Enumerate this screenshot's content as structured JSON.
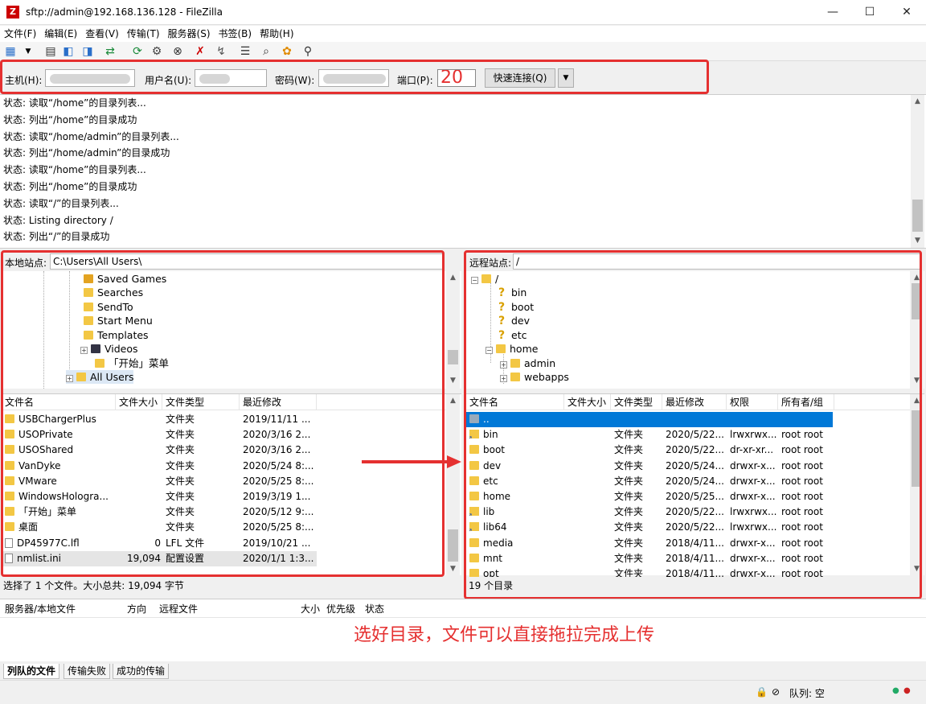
{
  "window": {
    "title": "sftp://admin@192.168.136.128 - FileZilla"
  },
  "menu": [
    "文件(F)",
    "编辑(E)",
    "查看(V)",
    "传输(T)",
    "服务器(S)",
    "书签(B)",
    "帮助(H)"
  ],
  "toolbar_icons": [
    "site-manager-icon",
    "dropdown-icon",
    "toggle-log-icon",
    "toggle-local-tree-icon",
    "toggle-remote-tree-icon",
    "toggle-queue-icon",
    "refresh-icon",
    "process-queue-icon",
    "cancel-icon",
    "disconnect-icon",
    "reconnect-icon",
    "filter-icon",
    "compare-icon",
    "sync-browse-icon",
    "search-icon"
  ],
  "quickconnect": {
    "host_label": "主机(H):",
    "host_value": "",
    "user_label": "用户名(U):",
    "user_value": "",
    "pass_label": "密码(W):",
    "pass_value": "",
    "port_label": "端口(P):",
    "port_value": "20",
    "connect_label": "快速连接(Q)"
  },
  "log": [
    "状态:  读取“/home”的目录列表...",
    "状态:  列出“/home”的目录成功",
    "状态:  读取“/home/admin”的目录列表...",
    "状态:  列出“/home/admin”的目录成功",
    "状态:  读取“/home”的目录列表...",
    "状态:  列出“/home”的目录成功",
    "状态:  读取“/”的目录列表...",
    "状态:  Listing directory /",
    "状态:  列出“/”的目录成功"
  ],
  "local": {
    "site_label": "本地站点:",
    "path": "C:\\Users\\All Users\\",
    "tree": [
      "Saved Games",
      "Searches",
      "SendTo",
      "Start Menu",
      "Templates",
      "Videos",
      "「开始」菜单",
      "All Users"
    ],
    "headers": [
      "文件名",
      "文件大小",
      "文件类型",
      "最近修改"
    ],
    "files": [
      {
        "name": "USBChargerPlus",
        "size": "",
        "type": "文件夹",
        "modified": "2019/11/11 ..."
      },
      {
        "name": "USOPrivate",
        "size": "",
        "type": "文件夹",
        "modified": "2020/3/16 2..."
      },
      {
        "name": "USOShared",
        "size": "",
        "type": "文件夹",
        "modified": "2020/3/16 2..."
      },
      {
        "name": "VanDyke",
        "size": "",
        "type": "文件夹",
        "modified": "2020/5/24 8:..."
      },
      {
        "name": "VMware",
        "size": "",
        "type": "文件夹",
        "modified": "2020/5/25 8:..."
      },
      {
        "name": "WindowsHologra...",
        "size": "",
        "type": "文件夹",
        "modified": "2019/3/19 1..."
      },
      {
        "name": "「开始」菜单",
        "size": "",
        "type": "文件夹",
        "modified": "2020/5/12 9:..."
      },
      {
        "name": "桌面",
        "size": "",
        "type": "文件夹",
        "modified": "2020/5/25 8:..."
      },
      {
        "name": "DP45977C.lfl",
        "size": "0",
        "type": "LFL 文件",
        "modified": "2019/10/21 ..."
      },
      {
        "name": "nmlist.ini",
        "size": "19,094",
        "type": "配置设置",
        "modified": "2020/1/1 1:3..."
      }
    ],
    "status": "选择了 1 个文件。大小总共: 19,094 字节"
  },
  "remote": {
    "site_label": "远程站点:",
    "path": "/",
    "tree": [
      "/",
      "bin",
      "boot",
      "dev",
      "etc",
      "home",
      "admin",
      "webapps"
    ],
    "headers": [
      "文件名",
      "文件大小",
      "文件类型",
      "最近修改",
      "权限",
      "所有者/组"
    ],
    "files": [
      {
        "name": "..",
        "size": "",
        "type": "",
        "modified": "",
        "perm": "",
        "owner": ""
      },
      {
        "name": "bin",
        "size": "",
        "type": "文件夹",
        "modified": "2020/5/22...",
        "perm": "lrwxrwx...",
        "owner": "root root"
      },
      {
        "name": "boot",
        "size": "",
        "type": "文件夹",
        "modified": "2020/5/22...",
        "perm": "dr-xr-xr...",
        "owner": "root root"
      },
      {
        "name": "dev",
        "size": "",
        "type": "文件夹",
        "modified": "2020/5/24...",
        "perm": "drwxr-x...",
        "owner": "root root"
      },
      {
        "name": "etc",
        "size": "",
        "type": "文件夹",
        "modified": "2020/5/24...",
        "perm": "drwxr-x...",
        "owner": "root root"
      },
      {
        "name": "home",
        "size": "",
        "type": "文件夹",
        "modified": "2020/5/25...",
        "perm": "drwxr-x...",
        "owner": "root root"
      },
      {
        "name": "lib",
        "size": "",
        "type": "文件夹",
        "modified": "2020/5/22...",
        "perm": "lrwxrwx...",
        "owner": "root root"
      },
      {
        "name": "lib64",
        "size": "",
        "type": "文件夹",
        "modified": "2020/5/22...",
        "perm": "lrwxrwx...",
        "owner": "root root"
      },
      {
        "name": "media",
        "size": "",
        "type": "文件夹",
        "modified": "2018/4/11...",
        "perm": "drwxr-x...",
        "owner": "root root"
      },
      {
        "name": "mnt",
        "size": "",
        "type": "文件夹",
        "modified": "2018/4/11...",
        "perm": "drwxr-x...",
        "owner": "root root"
      },
      {
        "name": "opt",
        "size": "",
        "type": "文件夹",
        "modified": "2018/4/11...",
        "perm": "drwxr-x...",
        "owner": "root root"
      }
    ],
    "status": "19 个目录"
  },
  "queue": {
    "headers": [
      "服务器/本地文件",
      "方向",
      "远程文件",
      "大小",
      "优先级",
      "状态"
    ],
    "tabs": [
      "列队的文件",
      "传输失败",
      "成功的传输"
    ]
  },
  "annotation": "选好目录，文件可以直接拖拉完成上传",
  "bottom": {
    "queue_status": "队列: 空"
  },
  "colors": {
    "annotation": "#e53030",
    "selection": "#0078d7",
    "folder": "#f3c744"
  }
}
